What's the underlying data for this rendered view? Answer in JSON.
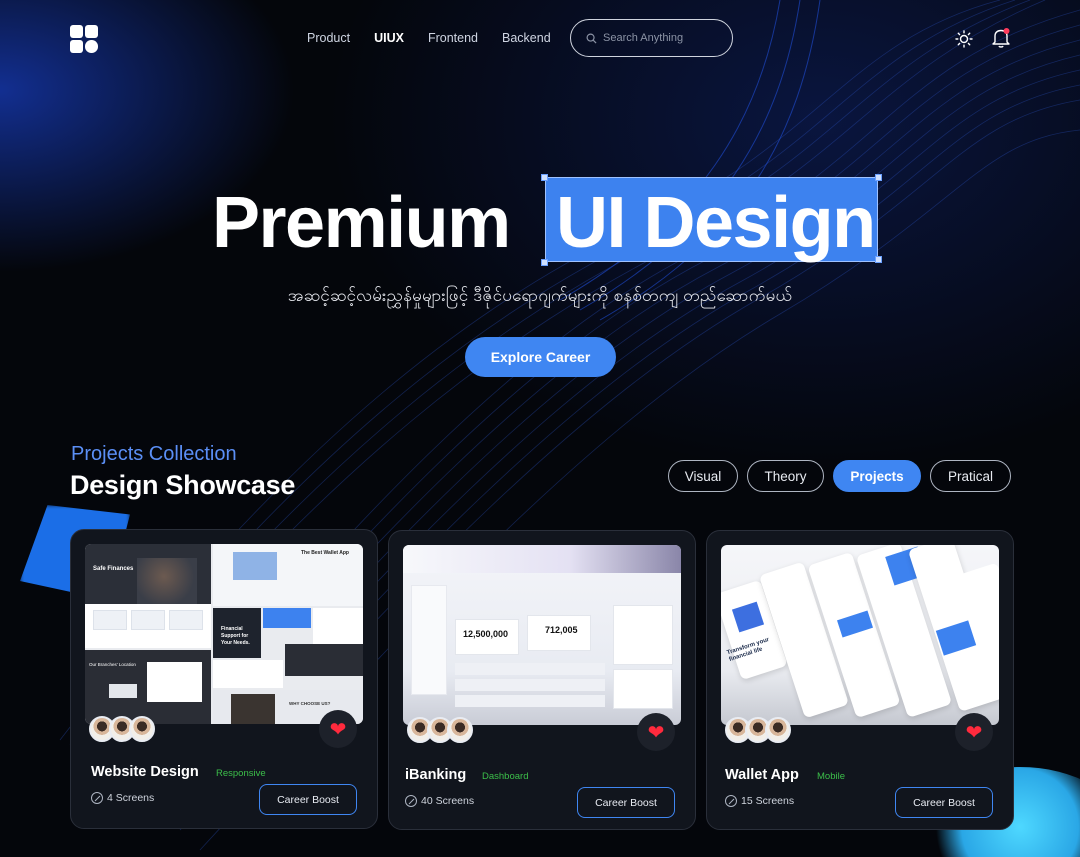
{
  "nav": {
    "menu": [
      {
        "label": "Product",
        "active": false
      },
      {
        "label": "UIUX",
        "active": true
      },
      {
        "label": "Frontend",
        "active": false
      },
      {
        "label": "Backend",
        "active": false
      }
    ],
    "search_placeholder": "Search Anything",
    "icons": [
      "logo-icon",
      "search-icon",
      "sun-icon",
      "bell-icon"
    ]
  },
  "hero": {
    "title_plain": "Premium",
    "title_highlight": "UI Design",
    "subtitle": "အဆင့်ဆင့်လမ်းညွှန်မှုများဖြင့် ဒီဇိုင်ပရောဂျက်များကို စနစ်တကျ တည်ဆောက်မယ်",
    "cta": "Explore Career"
  },
  "section": {
    "kicker": "Projects Collection",
    "title": "Design Showcase",
    "filters": [
      {
        "label": "Visual",
        "active": false
      },
      {
        "label": "Theory",
        "active": false
      },
      {
        "label": "Projects",
        "active": true
      },
      {
        "label": "Pratical",
        "active": false
      }
    ]
  },
  "cards": [
    {
      "title": "Website Design",
      "tag": "Responsive",
      "screens": "4 Screens",
      "button": "Career Boost"
    },
    {
      "title": "iBanking",
      "tag": "Dashboard",
      "screens": "40 Screens",
      "button": "Career Boost"
    },
    {
      "title": "Wallet App",
      "tag": "Mobile",
      "screens": "15 Screens",
      "button": "Career Boost"
    }
  ],
  "thumb_text": {
    "web_1": "Safe Finances",
    "web_2": "Financial Support for Your Needs.",
    "web_3": "The Best Wallet App",
    "web_4": "Our Branches' Location",
    "web_5": "WHY CHOOSE US?",
    "bank_1": "12,500,000",
    "bank_2": "712,005",
    "wallet_1": "Transform your financial life"
  },
  "colors": {
    "accent": "#3f86f2",
    "tag_green": "#3cbf4a",
    "heart": "#ff2a3d"
  }
}
